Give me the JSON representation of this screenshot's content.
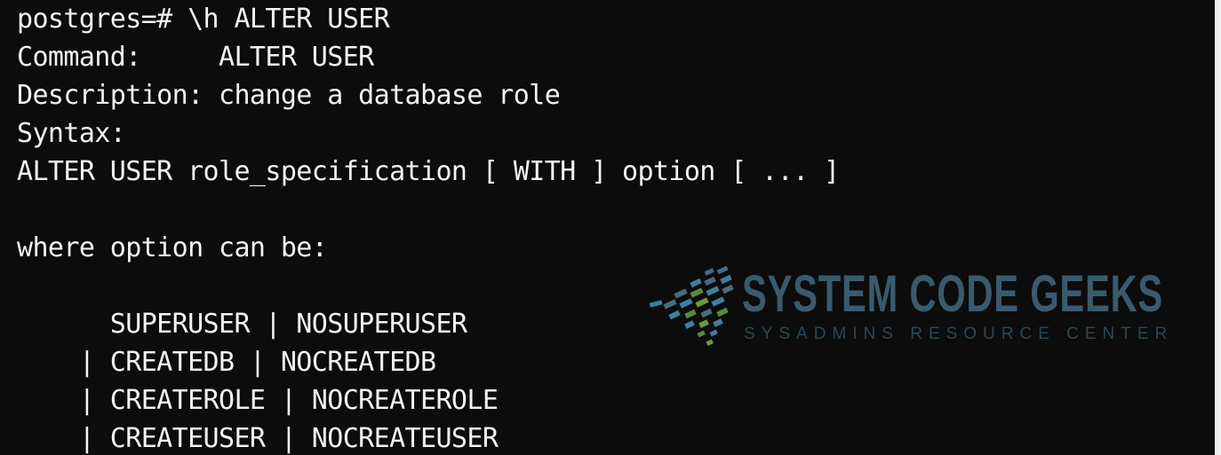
{
  "terminal": {
    "lines": [
      "postgres=# \\h ALTER USER",
      "Command:     ALTER USER",
      "Description: change a database role",
      "Syntax:",
      "ALTER USER role_specification [ WITH ] option [ ... ]",
      "",
      "where option can be:",
      "",
      "      SUPERUSER | NOSUPERUSER",
      "    | CREATEDB | NOCREATEDB",
      "    | CREATEROLE | NOCREATEROLE",
      "    | CREATEUSER | NOCREATEUSER"
    ],
    "background_color": "#0c0c0c",
    "text_color": "#f2f2f2"
  },
  "watermark": {
    "title": "SYSTEM CODE GEEKS",
    "subtitle": "SYSADMINS RESOURCE CENTER",
    "title_color": "#3a5a6e",
    "icon": "dot-swoosh-icon"
  }
}
